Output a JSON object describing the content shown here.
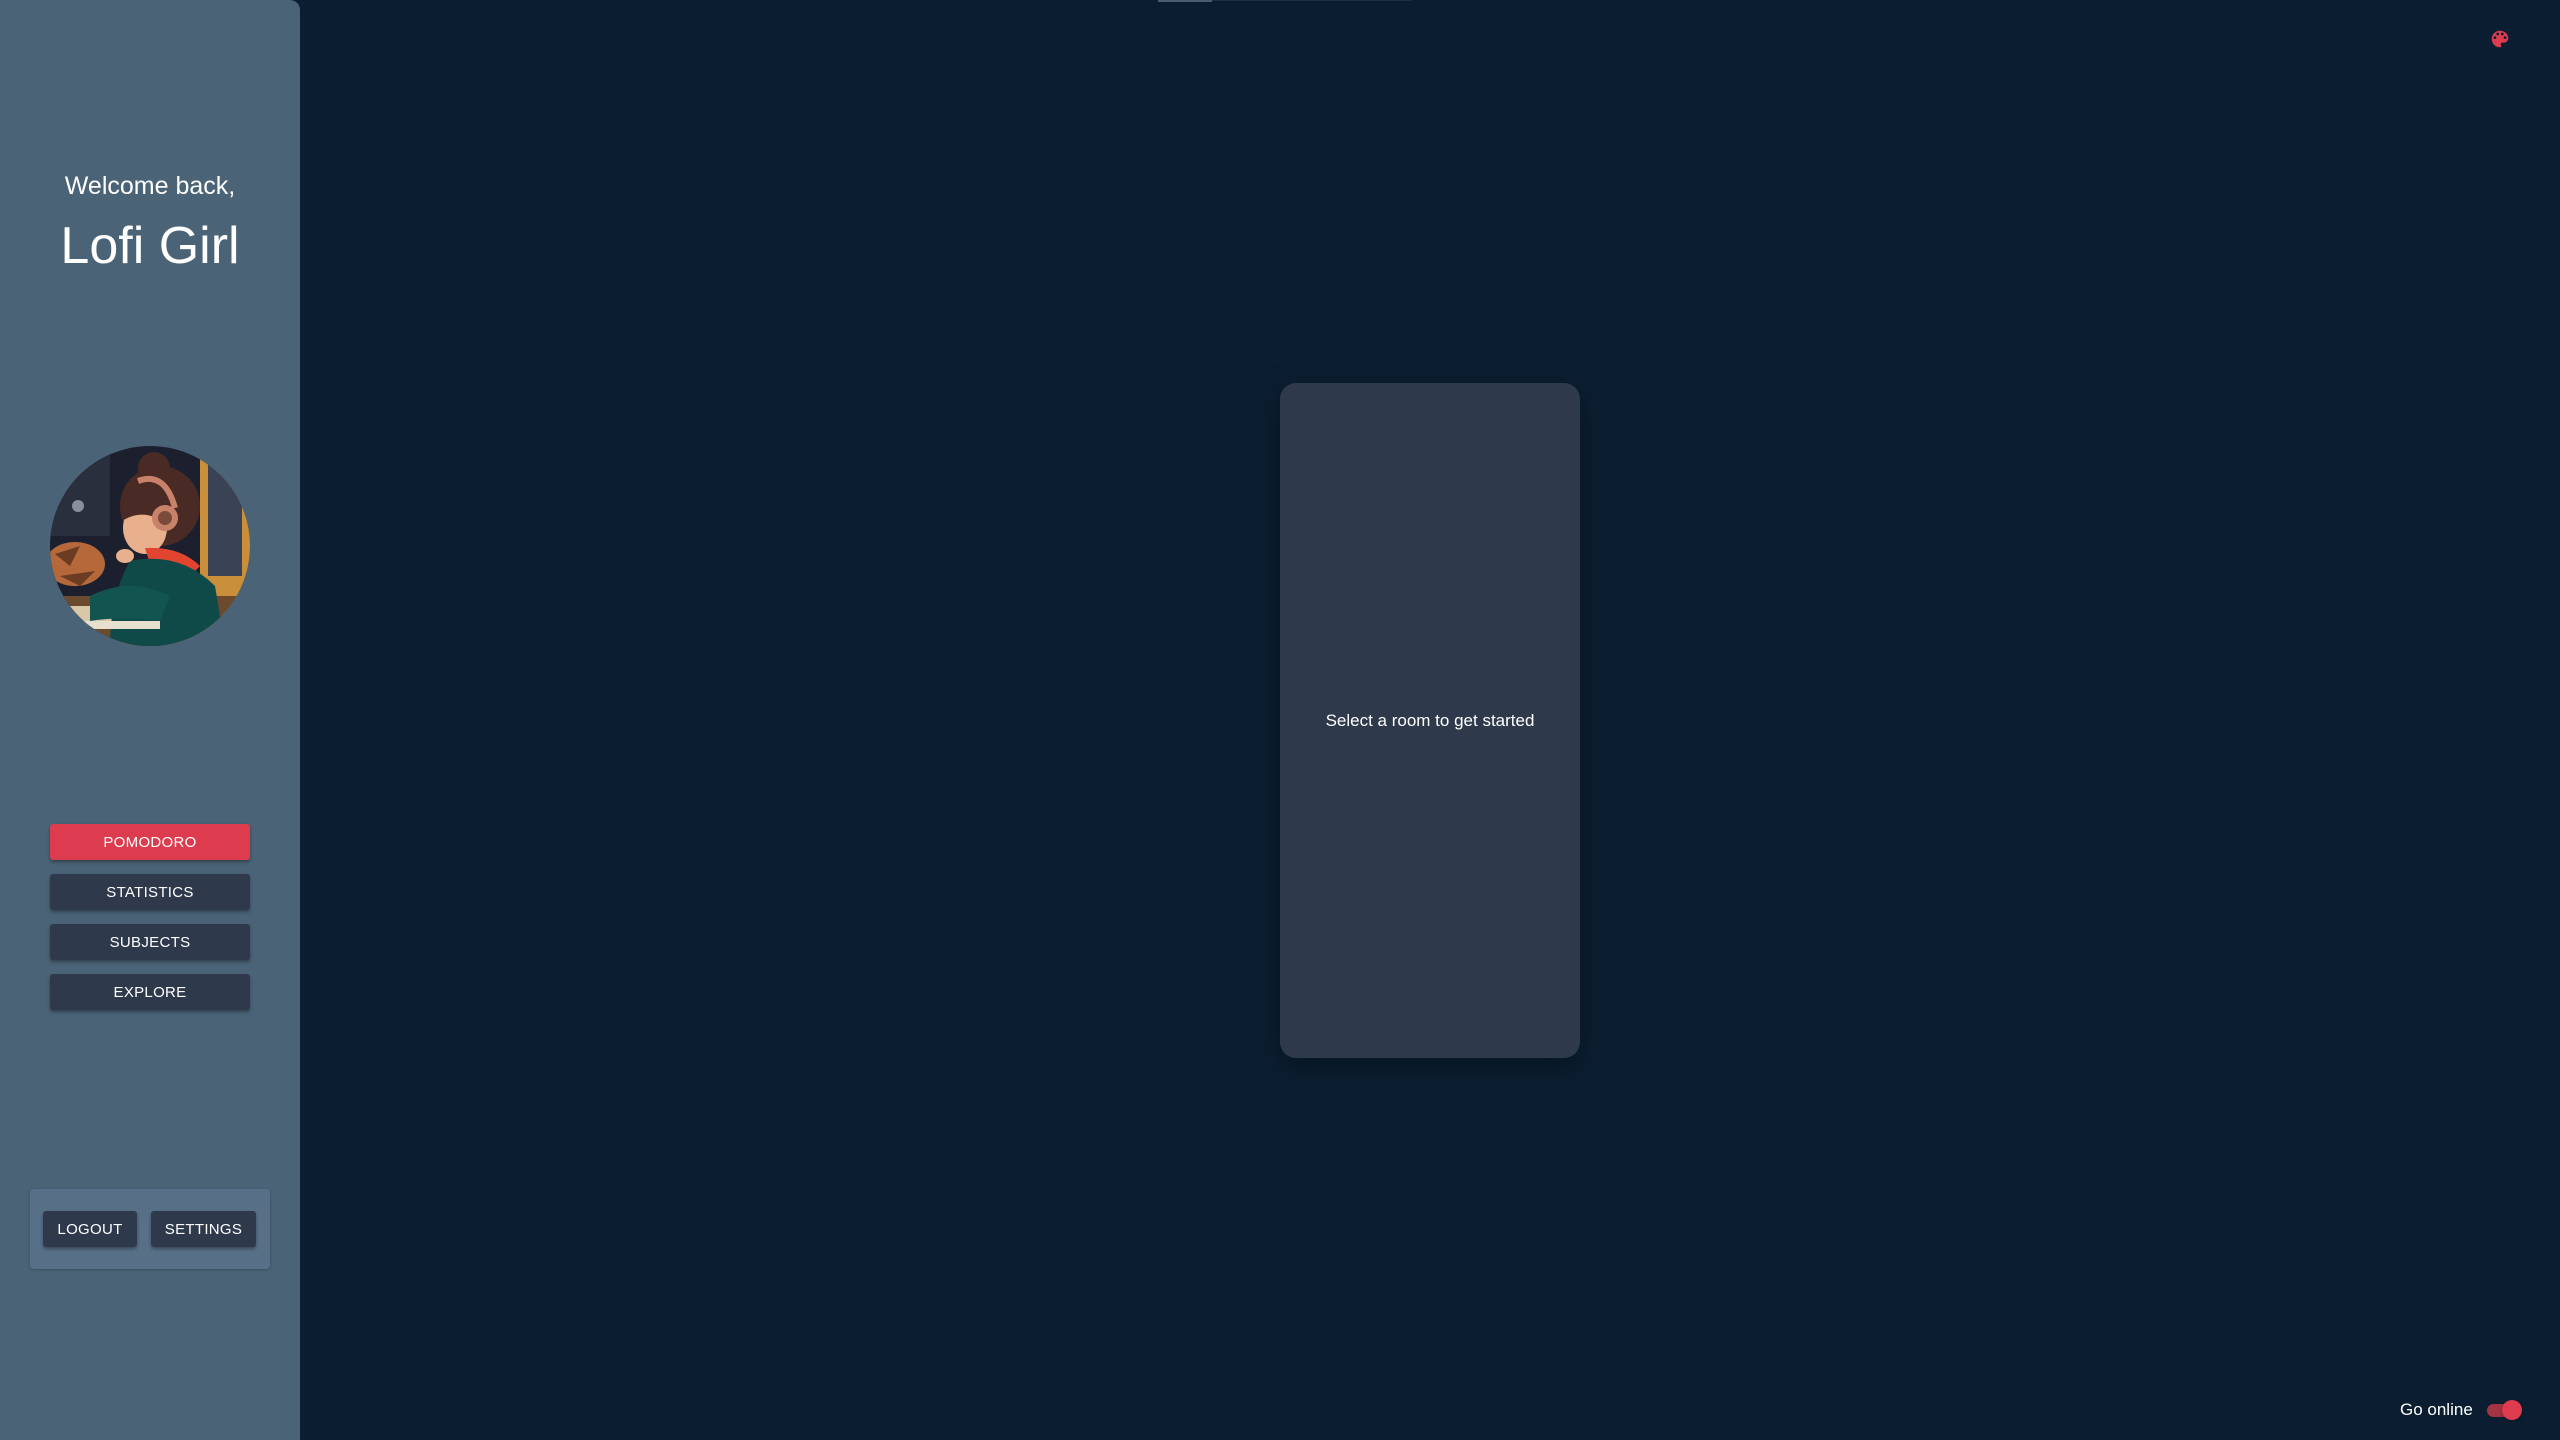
{
  "sidebar": {
    "welcome": "Welcome back,",
    "username": "Lofi Girl",
    "avatar": "lofi-girl-avatar",
    "nav": [
      {
        "label": "POMODORO",
        "active": true
      },
      {
        "label": "STATISTICS",
        "active": false
      },
      {
        "label": "SUBJECTS",
        "active": false
      },
      {
        "label": "EXPLORE",
        "active": false
      }
    ],
    "logout_label": "LOGOUT",
    "settings_label": "SETTINGS"
  },
  "main": {
    "room_prompt": "Select a room to get started",
    "theme_icon": "palette-icon"
  },
  "status": {
    "go_online_label": "Go online",
    "go_online_on": true
  },
  "colors": {
    "background": "#0b1e31",
    "sidebar": "#4b6377",
    "card": "#2e3a4b",
    "accent": "#dd3b4e"
  }
}
